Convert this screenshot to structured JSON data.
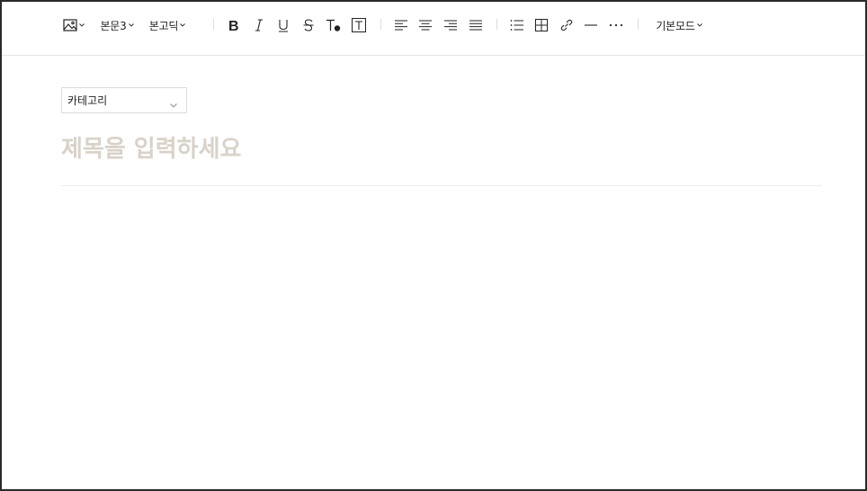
{
  "toolbar": {
    "image_icon": "image-icon",
    "paragraph_style": "본문3",
    "font_family": "본고딕",
    "mode": "기본모드",
    "icons": [
      "bold-icon",
      "italic-icon",
      "underline-icon",
      "strikethrough-icon",
      "text-color-icon",
      "text-background-icon",
      "align-left-icon",
      "align-center-icon",
      "align-right-icon",
      "align-justify-icon",
      "list-icon",
      "table-icon",
      "link-icon",
      "horizontal-line-icon",
      "more-icon"
    ]
  },
  "editor": {
    "category_label": "카테고리",
    "title_placeholder": "제목을 입력하세요"
  },
  "colors": {
    "placeholder": "#d8d2c8",
    "border": "#dcdcdc",
    "frame": "#2a2a2a"
  }
}
